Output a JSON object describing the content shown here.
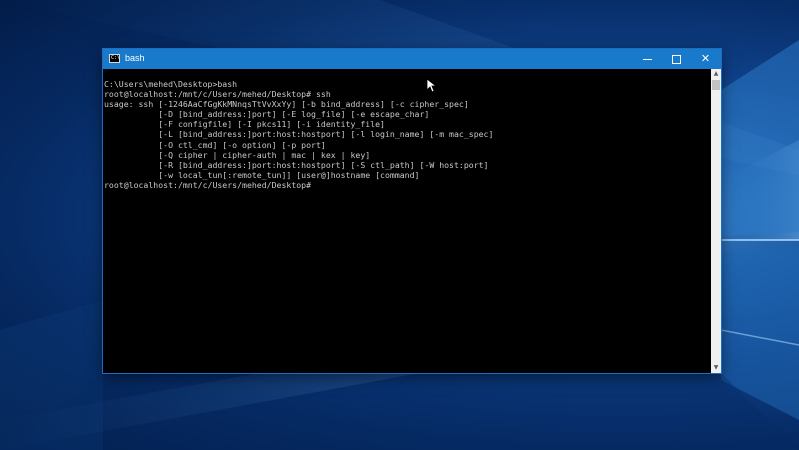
{
  "window": {
    "title": "bash",
    "icon": "console-app-icon",
    "icon_glyph": "C:\\",
    "controls": {
      "minimize": "minimize",
      "maximize": "maximize",
      "close": "✕"
    }
  },
  "console": {
    "lines": [
      "C:\\Users\\mehed\\Desktop>bash",
      "root@localhost:/mnt/c/Users/mehed/Desktop# ssh",
      "usage: ssh [-1246AaCfGgKkMNnqsTtVvXxYy] [-b bind_address] [-c cipher_spec]",
      "           [-D [bind_address:]port] [-E log_file] [-e escape_char]",
      "           [-F configfile] [-I pkcs11] [-i identity_file]",
      "           [-L [bind_address:]port:host:hostport] [-l login_name] [-m mac_spec]",
      "           [-O ctl_cmd] [-o option] [-p port]",
      "           [-Q cipher | cipher-auth | mac | kex | key]",
      "           [-R [bind_address:]port:host:hostport] [-S ctl_path] [-W host:port]",
      "           [-w local_tun[:remote_tun]] [user@]hostname [command]",
      "root@localhost:/mnt/c/Users/mehed/Desktop#"
    ]
  },
  "scrollbar": {
    "up": "▲",
    "down": "▼"
  },
  "colors": {
    "titlebar": "#1979ca",
    "console_bg": "#000000",
    "console_text": "#c8c8c8"
  }
}
